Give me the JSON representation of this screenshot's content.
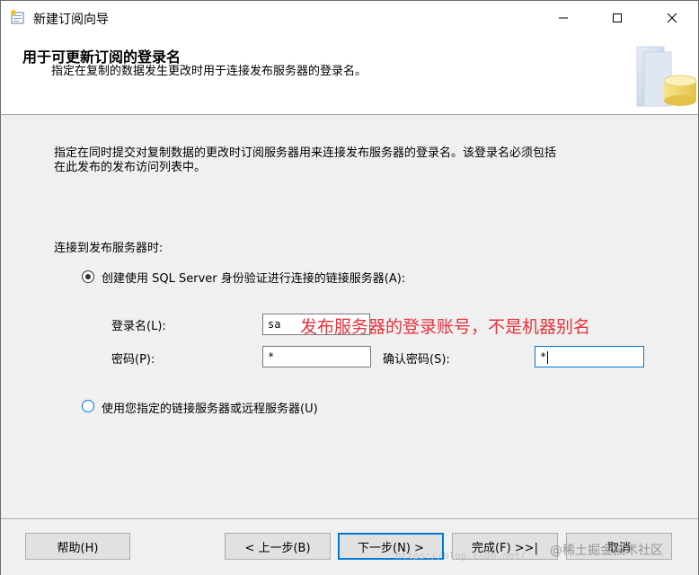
{
  "window": {
    "title": "新建订阅向导",
    "icon": "wizard-app-icon",
    "controls": [
      "minimize-icon",
      "maximize-icon",
      "close-icon"
    ]
  },
  "header": {
    "title": "用于可更新订阅的登录名",
    "subtitle": "指定在复制的数据发生更改时用于连接发布服务器的登录名。"
  },
  "description": {
    "line1": "指定在同时提交对复制数据的更改时订阅服务器用来连接发布服务器的登录名。该登录名必须包括",
    "line2": "在此发布的发布访问列表中。"
  },
  "connect_label": "连接到发布服务器时:",
  "option_a": {
    "label": "创建使用 SQL Server 身份验证进行连接的链接服务器(A):",
    "selected": true
  },
  "login": {
    "label": "登录名(L):",
    "value": "sa"
  },
  "password": {
    "label": "密码(P):",
    "value": "*"
  },
  "confirm": {
    "label": "确认密码(S):",
    "value": "*"
  },
  "annotation": "发布服务器的登录账号，不是机器别名",
  "option_b": {
    "label": "使用您指定的链接服务器或远程服务器(U)",
    "selected": false
  },
  "buttons": {
    "help": "帮助(H)",
    "back": "< 上一步(B)",
    "next": "下一步(N) >",
    "finish": "完成(F) >>|",
    "cancel": "取消"
  },
  "watermark": {
    "text": "@稀土掘金技术社区",
    "url": "https://blog.csdn.net/"
  },
  "colors": {
    "accent": "#0078d7",
    "annotation": "#e8323c",
    "button_face": "#e1e1e1"
  }
}
